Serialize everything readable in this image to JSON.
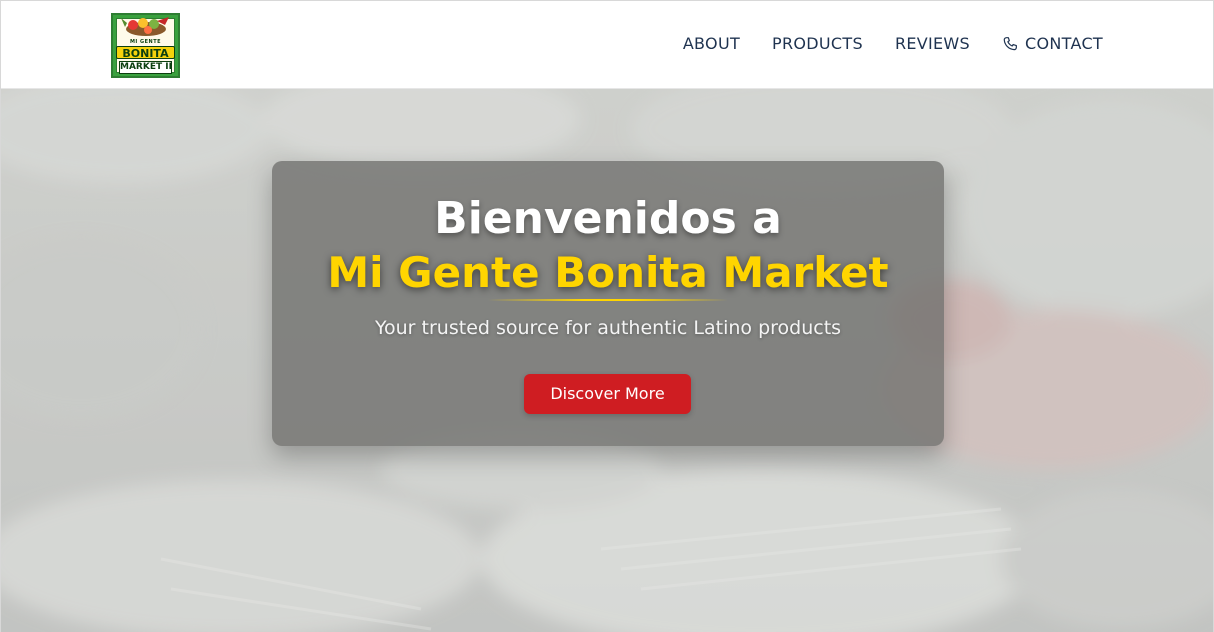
{
  "header": {
    "logo": {
      "small_text": "MI GENTE",
      "big_text": "BONITA",
      "sub_text": "MARKET II"
    },
    "nav": [
      {
        "label": "ABOUT",
        "icon": null
      },
      {
        "label": "PRODUCTS",
        "icon": null
      },
      {
        "label": "REVIEWS",
        "icon": null
      },
      {
        "label": "CONTACT",
        "icon": "phone-icon"
      }
    ]
  },
  "hero": {
    "title_line1": "Bienvenidos a",
    "title_line2": "Mi Gente Bonita Market",
    "subtitle": "Your trusted source for authentic Latino products",
    "cta_label": "Discover More"
  },
  "colors": {
    "nav_text": "#1f3350",
    "accent_yellow": "#ffd500",
    "cta_red": "#cf1d22",
    "logo_green": "#3aa13e"
  }
}
